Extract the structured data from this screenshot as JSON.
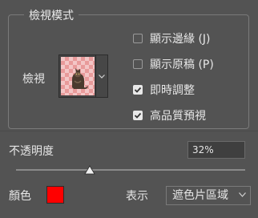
{
  "group": {
    "title": "檢視模式"
  },
  "view": {
    "label": "檢視"
  },
  "options": [
    {
      "label": "顯示邊緣 (J)",
      "checked": false
    },
    {
      "label": "顯示原稿 (P)",
      "checked": false
    },
    {
      "label": "即時調整",
      "checked": true
    },
    {
      "label": "高品質預視",
      "checked": true
    }
  ],
  "opacity": {
    "label": "不透明度",
    "value": "32%",
    "fraction": 0.32
  },
  "color": {
    "label": "顏色",
    "swatch": "#ff0000"
  },
  "show": {
    "label": "表示",
    "selected": "遮色片區域"
  }
}
